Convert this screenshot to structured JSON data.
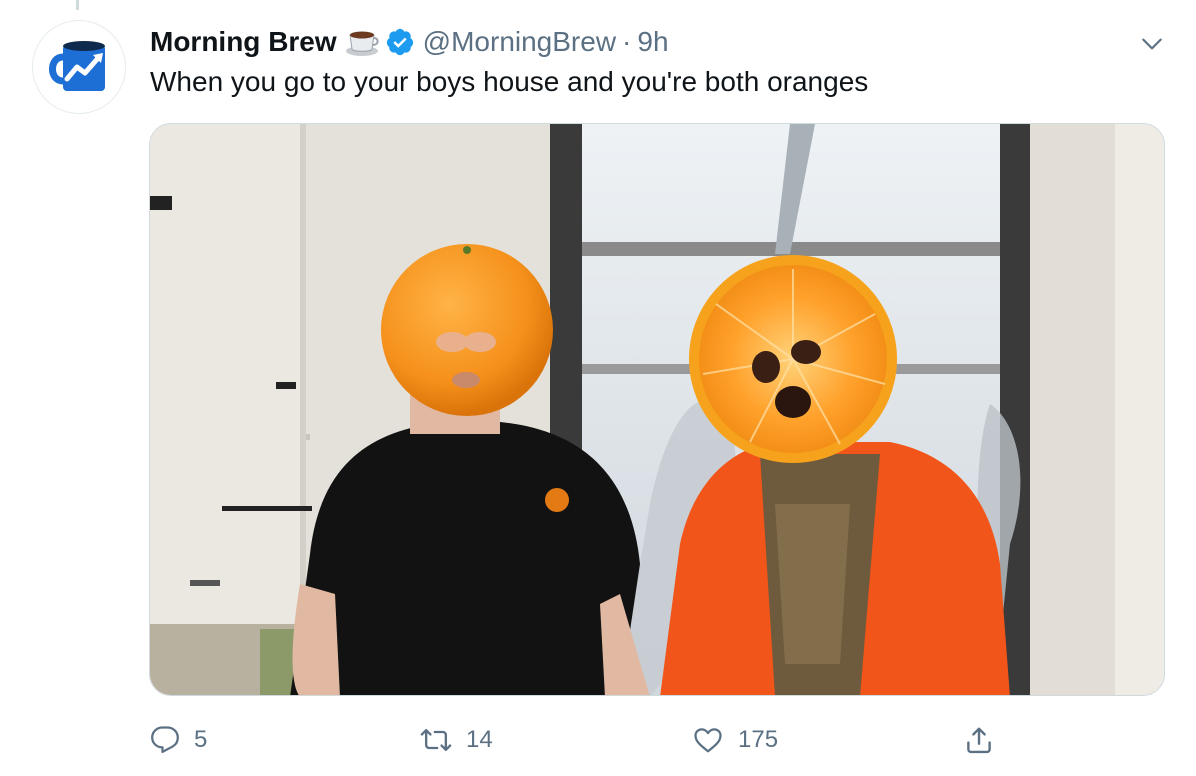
{
  "tweet": {
    "display_name": "Morning Brew",
    "name_emoji": "coffee-cup-emoji",
    "verified": true,
    "handle": "@MorningBrew",
    "separator": "·",
    "time": "9h",
    "text": "When you go to your boys house and you're both oranges"
  },
  "actions": {
    "reply_count": "5",
    "retweet_count": "14",
    "like_count": "175"
  },
  "colors": {
    "brand_blue": "#1d9bf0",
    "text_primary": "#0f1419",
    "text_secondary": "#5b7083"
  }
}
